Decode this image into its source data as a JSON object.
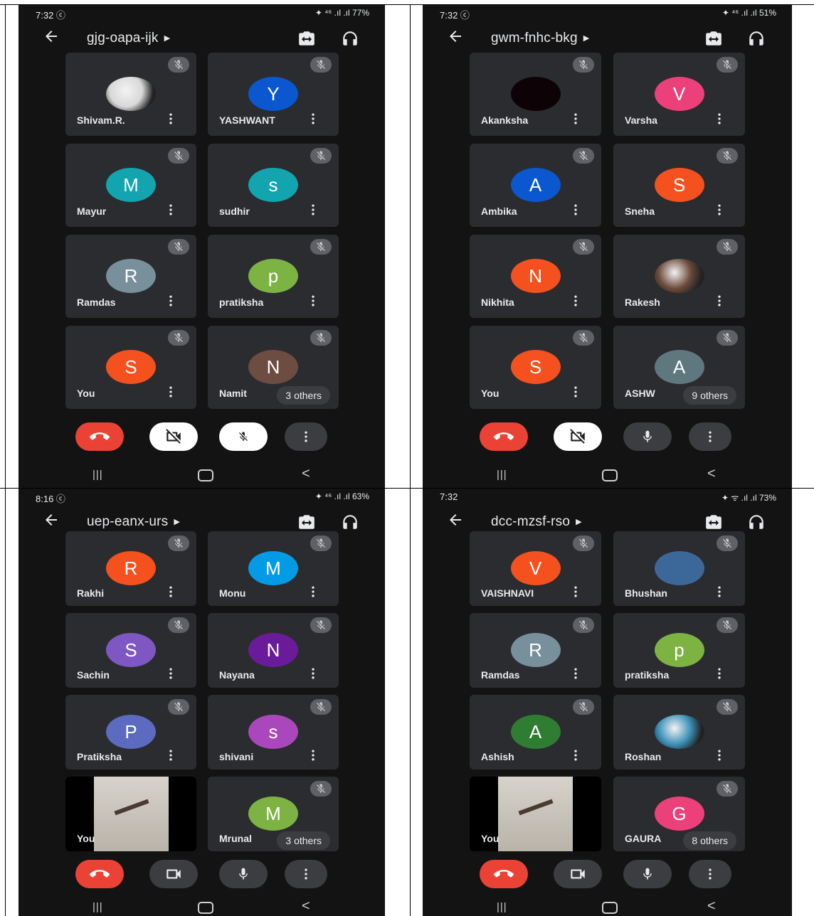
{
  "colors": {
    "end_call": "#ea4335",
    "tile_bg": "#2b2c2f",
    "panel_bg": "#131313",
    "control_dark": "#3c3d41",
    "control_light": "#ffffff"
  },
  "controls_icons": [
    "end-call-icon",
    "camera-icon",
    "microphone-icon",
    "more-vert-icon"
  ],
  "screens": [
    {
      "status_time": "7:32 ⓒ",
      "status_right": "✦ ⁴⁶ .ıl .ıl 77%",
      "meeting_code": "gjg-oapa-ijk",
      "participants": [
        {
          "name": "Shivam.R.",
          "letter": "",
          "color": "#d8d8d8",
          "photo": true
        },
        {
          "name": "YASHWANT",
          "letter": "Y",
          "color": "#0b57d0"
        },
        {
          "name": "Mayur",
          "letter": "M",
          "color": "#12a4af"
        },
        {
          "name": "sudhir",
          "letter": "s",
          "color": "#12a4af"
        },
        {
          "name": "Ramdas",
          "letter": "R",
          "color": "#78909c"
        },
        {
          "name": "pratiksha",
          "letter": "p",
          "color": "#7cb342"
        },
        {
          "name": "You",
          "letter": "S",
          "color": "#f4511e"
        },
        {
          "name": "Namit",
          "letter": "N",
          "color": "#6d4c41"
        }
      ],
      "others": "3 others",
      "camera_on": false,
      "mic_on": false
    },
    {
      "status_time": "7:32 ⓒ",
      "status_right": "✦ ⁴⁶ .ıl .ıl 51%",
      "meeting_code": "gwm-fnhc-bkg",
      "participants": [
        {
          "name": "Akanksha",
          "letter": "",
          "color": "#0d0306"
        },
        {
          "name": "Varsha",
          "letter": "V",
          "color": "#ec407a"
        },
        {
          "name": "Ambika",
          "letter": "A",
          "color": "#0b57d0"
        },
        {
          "name": "Sneha",
          "letter": "S",
          "color": "#f4511e"
        },
        {
          "name": "Nikhita",
          "letter": "N",
          "color": "#f4511e"
        },
        {
          "name": "Rakesh",
          "letter": "",
          "color": "#6b4a3a",
          "photo": true
        },
        {
          "name": "You",
          "letter": "S",
          "color": "#f4511e"
        },
        {
          "name": "ASHW",
          "letter": "A",
          "color": "#5f7880"
        }
      ],
      "others": "9 others",
      "camera_on": false,
      "mic_on": true
    },
    {
      "status_time": "8:16 ⓒ",
      "status_right": "✦ ⁴⁶ .ıl .ıl 63%",
      "meeting_code": "uep-eanx-urs",
      "participants": [
        {
          "name": "Rakhi",
          "letter": "R",
          "color": "#f4511e"
        },
        {
          "name": "Monu",
          "letter": "M",
          "color": "#039be5"
        },
        {
          "name": "Sachin",
          "letter": "S",
          "color": "#7e57c2"
        },
        {
          "name": "Nayana",
          "letter": "N",
          "color": "#6a1b9a"
        },
        {
          "name": "Pratiksha",
          "letter": "P",
          "color": "#5c6bc0"
        },
        {
          "name": "shivani",
          "letter": "s",
          "color": "#ab47bc"
        },
        {
          "name": "You",
          "letter": "",
          "color": "#000000",
          "video": true
        },
        {
          "name": "Mrunal",
          "letter": "M",
          "color": "#7cb342"
        }
      ],
      "others": "3 others",
      "camera_on": true,
      "mic_on": true
    },
    {
      "status_time": "7:32",
      "status_right": "✦ ᯤ .ıl .ıl 73%",
      "meeting_code": "dcc-mzsf-rso",
      "participants": [
        {
          "name": "VAISHNAVI",
          "letter": "V",
          "color": "#f4511e"
        },
        {
          "name": "Bhushan",
          "letter": "",
          "color": "#3c6899"
        },
        {
          "name": "Ramdas",
          "letter": "R",
          "color": "#78909c"
        },
        {
          "name": "pratiksha",
          "letter": "p",
          "color": "#7cb342"
        },
        {
          "name": "Ashish",
          "letter": "A",
          "color": "#2e7d32"
        },
        {
          "name": "Roshan",
          "letter": "",
          "color": "#3a8fb7",
          "photo": true
        },
        {
          "name": "You",
          "letter": "",
          "color": "#000000",
          "video": true
        },
        {
          "name": "GAURA",
          "letter": "G",
          "color": "#ec407a"
        }
      ],
      "others": "8 others",
      "camera_on": true,
      "mic_on": true
    }
  ]
}
